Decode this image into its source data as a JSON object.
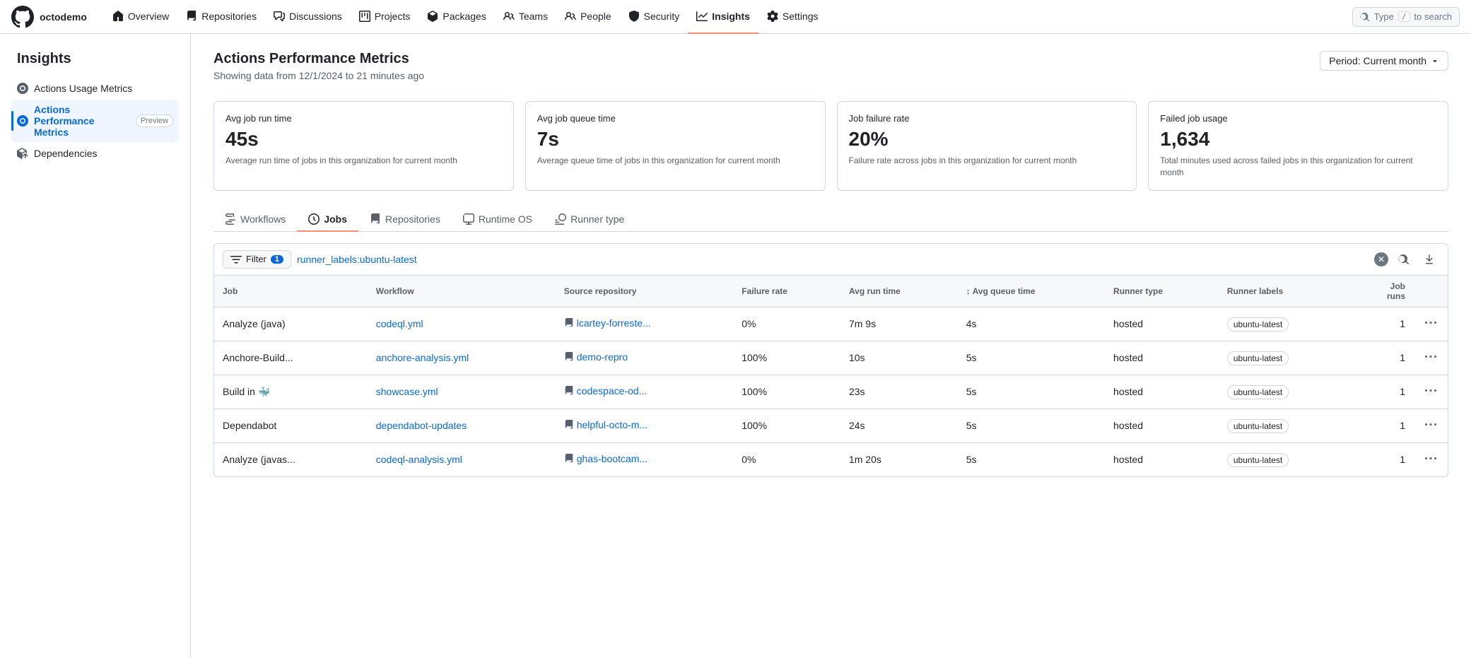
{
  "org": {
    "name": "octodemo"
  },
  "nav": {
    "items": [
      {
        "label": "Overview",
        "icon": "home",
        "active": false
      },
      {
        "label": "Repositories",
        "icon": "repo",
        "active": false
      },
      {
        "label": "Discussions",
        "icon": "discussions",
        "active": false
      },
      {
        "label": "Projects",
        "icon": "projects",
        "active": false
      },
      {
        "label": "Packages",
        "icon": "packages",
        "active": false
      },
      {
        "label": "Teams",
        "icon": "teams",
        "active": false
      },
      {
        "label": "People",
        "icon": "people",
        "active": false
      },
      {
        "label": "Security",
        "icon": "security",
        "active": false
      },
      {
        "label": "Insights",
        "icon": "insights",
        "active": true
      },
      {
        "label": "Settings",
        "icon": "settings",
        "active": false
      }
    ],
    "search_placeholder": "Type / to search"
  },
  "sidebar": {
    "title": "Insights",
    "items": [
      {
        "label": "Actions Usage Metrics",
        "active": false,
        "preview": false
      },
      {
        "label": "Actions Performance Metrics",
        "active": true,
        "preview": true
      },
      {
        "label": "Dependencies",
        "active": false,
        "preview": false
      }
    ]
  },
  "page": {
    "title": "Actions Performance Metrics",
    "subtitle": "Showing data from 12/1/2024 to 21 minutes ago",
    "period_btn": "Period: Current month"
  },
  "stats": [
    {
      "label": "Avg job run time",
      "value": "45s",
      "desc": "Average run time of jobs in this organization for current month"
    },
    {
      "label": "Avg job queue time",
      "value": "7s",
      "desc": "Average queue time of jobs in this organization for current month"
    },
    {
      "label": "Job failure rate",
      "value": "20%",
      "desc": "Failure rate across jobs in this organization for current month"
    },
    {
      "label": "Failed job usage",
      "value": "1,634",
      "desc": "Total minutes used across failed jobs in this organization for current month"
    }
  ],
  "tabs": [
    {
      "label": "Workflows",
      "icon": "workflow",
      "active": false
    },
    {
      "label": "Jobs",
      "icon": "jobs",
      "active": true
    },
    {
      "label": "Repositories",
      "icon": "repo",
      "active": false
    },
    {
      "label": "Runtime OS",
      "icon": "os",
      "active": false
    },
    {
      "label": "Runner type",
      "icon": "runner",
      "active": false
    }
  ],
  "filter": {
    "label": "Filter",
    "count": "1",
    "value": "runner_labels:",
    "tag": "ubuntu-latest"
  },
  "table": {
    "columns": [
      {
        "label": "Job",
        "sortable": false
      },
      {
        "label": "Workflow",
        "sortable": false
      },
      {
        "label": "Source repository",
        "sortable": false
      },
      {
        "label": "Failure rate",
        "sortable": false
      },
      {
        "label": "Avg run time",
        "sortable": false
      },
      {
        "label": "Avg queue time",
        "sortable": true
      },
      {
        "label": "Runner type",
        "sortable": false
      },
      {
        "label": "Runner labels",
        "sortable": false
      },
      {
        "label": "Job runs",
        "sortable": false
      }
    ],
    "rows": [
      {
        "job": "Analyze (java)",
        "workflow": "codeql.yml",
        "source_repo": "lcartey-forreste...",
        "failure_rate": "0%",
        "avg_run_time": "7m 9s",
        "avg_queue_time": "4s",
        "runner_type": "hosted",
        "runner_labels": "ubuntu-latest",
        "job_runs": "1"
      },
      {
        "job": "Anchore-Build...",
        "workflow": "anchore-analysis.yml",
        "source_repo": "demo-repro",
        "failure_rate": "100%",
        "avg_run_time": "10s",
        "avg_queue_time": "5s",
        "runner_type": "hosted",
        "runner_labels": "ubuntu-latest",
        "job_runs": "1"
      },
      {
        "job": "Build in 🐳",
        "workflow": "showcase.yml",
        "source_repo": "codespace-od...",
        "failure_rate": "100%",
        "avg_run_time": "23s",
        "avg_queue_time": "5s",
        "runner_type": "hosted",
        "runner_labels": "ubuntu-latest",
        "job_runs": "1"
      },
      {
        "job": "Dependabot",
        "workflow": "dependabot-updates",
        "source_repo": "helpful-octo-m...",
        "failure_rate": "100%",
        "avg_run_time": "24s",
        "avg_queue_time": "5s",
        "runner_type": "hosted",
        "runner_labels": "ubuntu-latest",
        "job_runs": "1"
      },
      {
        "job": "Analyze (javas...",
        "workflow": "codeql-analysis.yml",
        "source_repo": "ghas-bootcam...",
        "failure_rate": "0%",
        "avg_run_time": "1m 20s",
        "avg_queue_time": "5s",
        "runner_type": "hosted",
        "runner_labels": "ubuntu-latest",
        "job_runs": "1"
      }
    ]
  }
}
